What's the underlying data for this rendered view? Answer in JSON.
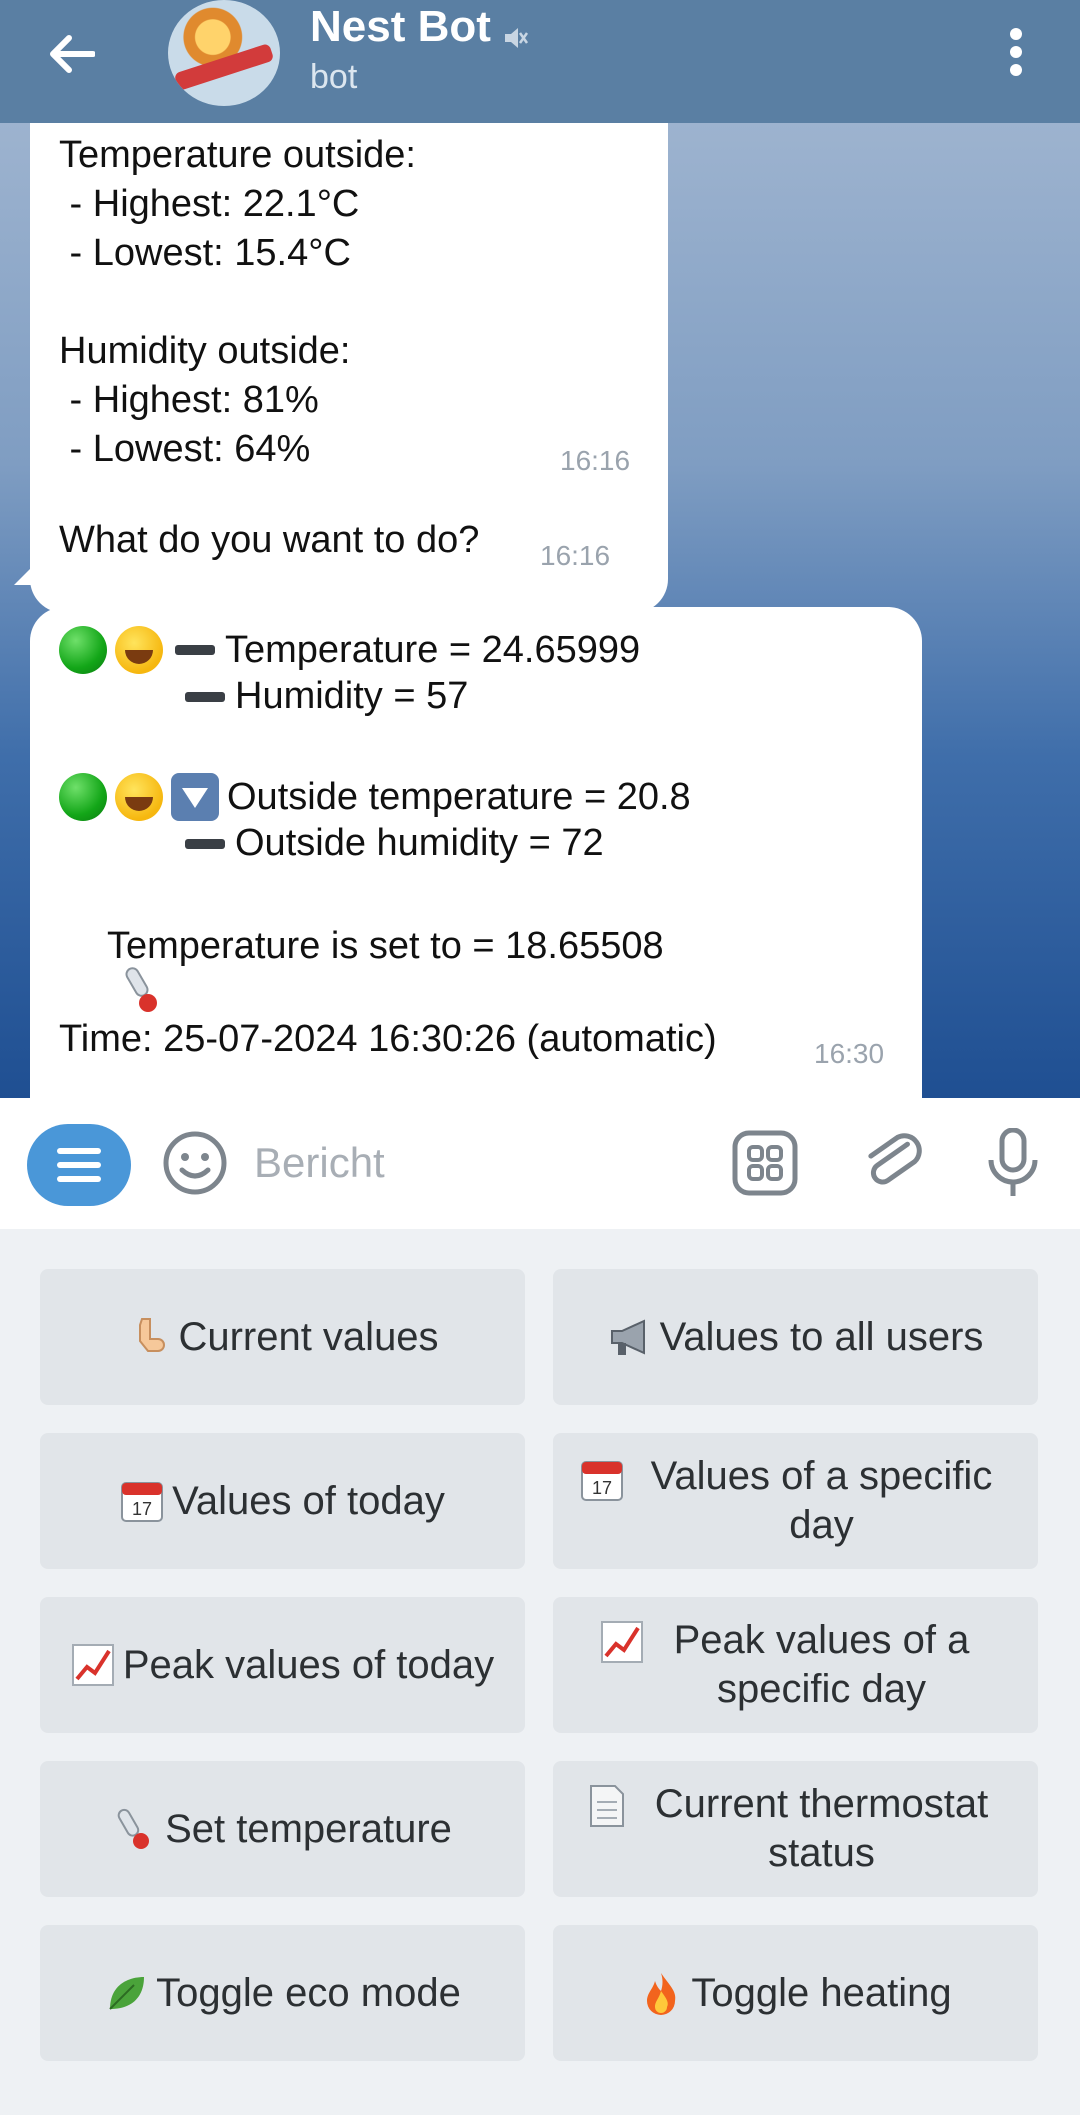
{
  "header": {
    "title": "Nest Bot",
    "subtitle": "bot"
  },
  "messages": [
    {
      "lines": [
        "Temperature outside:",
        " - Highest: 22.1°C",
        " - Lowest: 15.4°C",
        "",
        "Humidity outside:",
        " - Highest: 81%",
        " - Lowest: 64%"
      ],
      "time": "16:16"
    },
    {
      "text": "What do you want to do?",
      "time": "16:16"
    },
    {
      "l1": "Temperature = 24.65999",
      "l2": "Humidity = 57",
      "l3": "Outside temperature = 20.8",
      "l4": "Outside humidity = 72",
      "l5": "Temperature is set to = 18.65508",
      "l6": "Time: 25-07-2024 16:30:26 (automatic)",
      "time": "16:30"
    }
  ],
  "input": {
    "placeholder": "Bericht"
  },
  "keyboard": [
    {
      "label": "Current values",
      "icon": "pointing-down-hand-icon"
    },
    {
      "label": "Values to all users",
      "icon": "megaphone-icon"
    },
    {
      "label": "Values of today",
      "icon": "calendar-icon"
    },
    {
      "label": "Values of a specific day",
      "icon": "calendar-icon"
    },
    {
      "label": "Peak values of today",
      "icon": "chart-increasing-icon"
    },
    {
      "label": "Peak values of a specific day",
      "icon": "chart-increasing-icon"
    },
    {
      "label": "Set temperature",
      "icon": "thermometer-icon"
    },
    {
      "label": "Current thermostat status",
      "icon": "page-icon"
    },
    {
      "label": "Toggle eco mode",
      "icon": "leaf-icon"
    },
    {
      "label": "Toggle heating",
      "icon": "fire-icon"
    }
  ],
  "colors": {
    "header": "#5a7fa3",
    "accent": "#4a97d8",
    "keyboard_button": "#e1e5e9"
  }
}
